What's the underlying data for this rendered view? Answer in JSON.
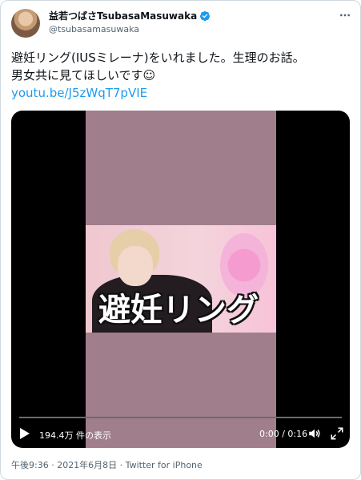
{
  "user": {
    "display_name": "益若つばさTsubasaMasuwaka",
    "handle": "@tsubasamasuwaka"
  },
  "tweet": {
    "line1": "避妊リング(IUSミレーナ)をいれました。生理のお話。",
    "line2": "男女共に見てほしいです☺",
    "link": "youtu.be/J5zWqT7pVIE"
  },
  "video": {
    "caption": "避妊リング",
    "views": "194.4万 件の表示",
    "time": "0:00 / 0:16",
    "progress": 0
  },
  "footer": {
    "timestamp": "午後9:36 · 2021年6月8日 · Twitter for iPhone"
  },
  "icons": {
    "verified": "verified-badge-icon",
    "more": "more-icon",
    "play": "play-icon",
    "volume": "volume-icon",
    "fullscreen": "fullscreen-icon"
  },
  "colors": {
    "link": "#1d9bf0",
    "verified": "#1d9bf0",
    "text": "#0f1419",
    "secondary": "#536471"
  }
}
